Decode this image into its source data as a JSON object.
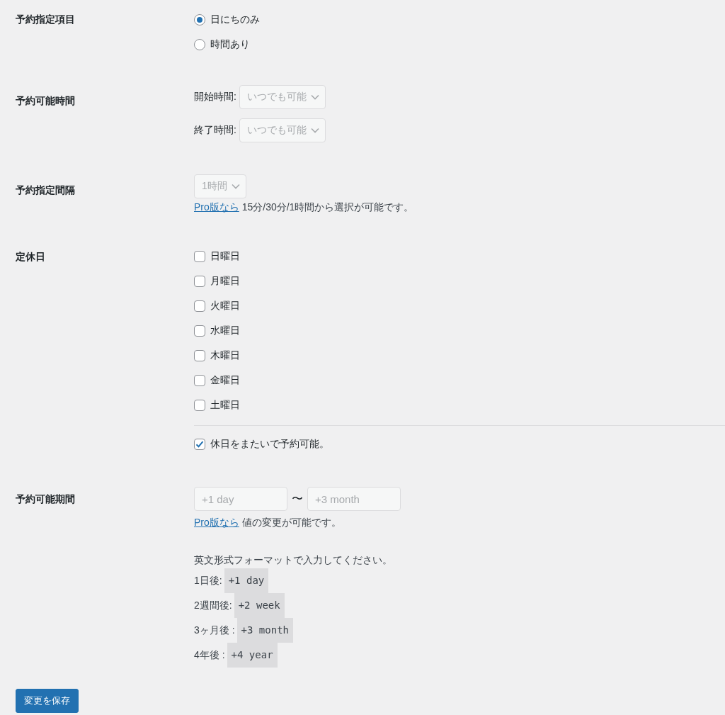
{
  "sections": [
    {
      "label": "予約指定項目",
      "kind": "radios",
      "options": [
        {
          "label": "日にちのみ",
          "selected": true
        },
        {
          "label": "時間あり",
          "selected": false
        }
      ]
    },
    {
      "label": "予約可能時間",
      "kind": "selects",
      "selects": [
        {
          "label": "開始時間:",
          "value": "いつでも可能",
          "disabled": true
        },
        {
          "label": "終了時間:",
          "value": "いつでも可能",
          "disabled": true
        }
      ]
    },
    {
      "label": "予約指定間隔",
      "kind": "interval",
      "select": {
        "value": "1時間",
        "disabled": true
      },
      "note": {
        "link": "Pro版なら",
        "text": "15分/30分/1時間から選択が可能です。"
      }
    },
    {
      "label": "定休日",
      "kind": "checkboxes",
      "days": [
        {
          "label": "日曜日",
          "checked": false
        },
        {
          "label": "月曜日",
          "checked": false
        },
        {
          "label": "火曜日",
          "checked": false
        },
        {
          "label": "水曜日",
          "checked": false
        },
        {
          "label": "木曜日",
          "checked": false
        },
        {
          "label": "金曜日",
          "checked": false
        },
        {
          "label": "土曜日",
          "checked": false
        }
      ],
      "extra": {
        "label": "休日をまたいで予約可能。",
        "checked": true
      }
    },
    {
      "label": "予約可能期間",
      "kind": "range",
      "from": {
        "placeholder": "+1 day"
      },
      "separator": "〜",
      "to": {
        "placeholder": "+3 month"
      },
      "note": {
        "link": "Pro版なら",
        "text": "値の変更が可能です。"
      },
      "help": "英文形式フォーマットで入力してください。",
      "examples": [
        {
          "label": "1日後:",
          "code": "+1 day"
        },
        {
          "label": "2週間後:",
          "code": "+2 week"
        },
        {
          "label": "3ヶ月後 :",
          "code": "+3 month"
        },
        {
          "label": "4年後 :",
          "code": "+4 year"
        }
      ]
    }
  ],
  "save_button": "変更を保存"
}
